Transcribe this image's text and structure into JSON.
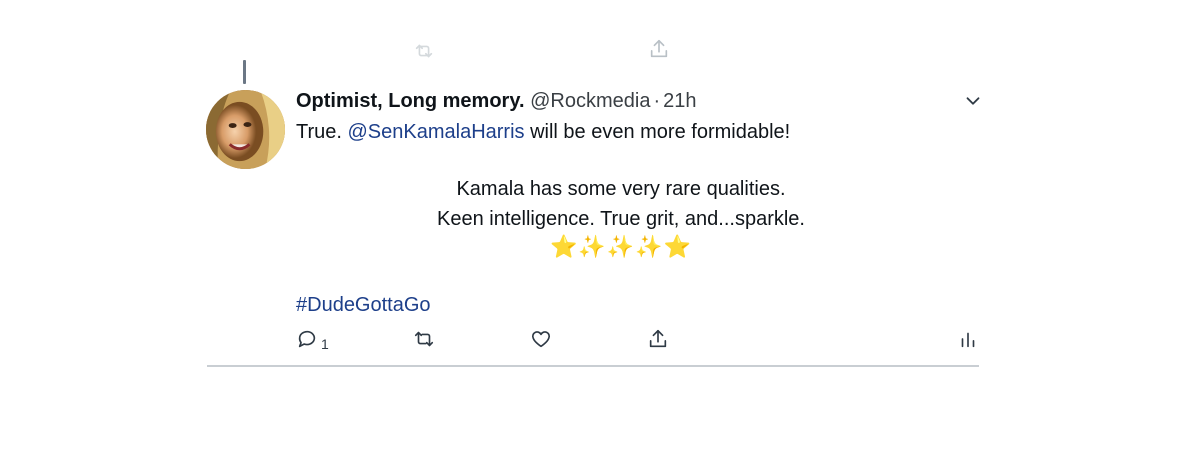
{
  "ghost_row": {
    "icons": [
      "retweet-icon",
      "share-icon"
    ]
  },
  "tweet": {
    "display_name": "Optimist, Long memory.",
    "handle": "@Rockmedia",
    "separator": "·",
    "time": "21h",
    "text_before_mention": "True. ",
    "mention": "@SenKamalaHarris",
    "text_after_mention": " will be even more formidable!",
    "centered_line_1": "Kamala has some very rare qualities.",
    "centered_line_2": "Keen intelligence. True grit, and...sparkle.",
    "emoji_line": "⭐✨✨✨⭐",
    "hashtag": "#DudeGottaGo",
    "reply_count": "1"
  },
  "actions": {
    "icons": [
      "reply-icon",
      "retweet-icon",
      "like-icon",
      "share-icon",
      "analytics-icon"
    ]
  },
  "colors": {
    "link": "#1d3f8a",
    "icon": "#2f3a45",
    "divider": "#c9ced3"
  }
}
